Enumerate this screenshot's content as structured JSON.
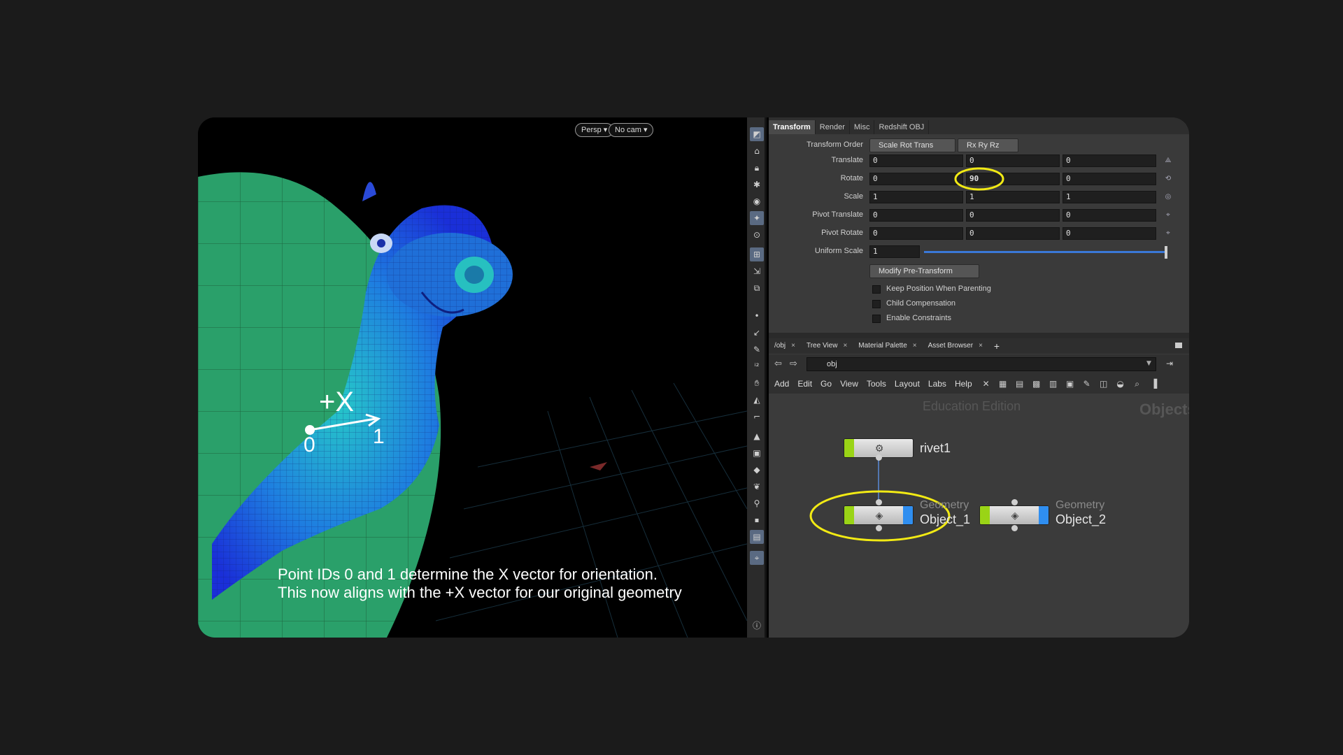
{
  "viewport": {
    "persp_label": "Persp ▾",
    "cam_label": "No cam ▾",
    "axis_label": "+X",
    "point0": "0",
    "point1": "1",
    "caption_line1": "Point IDs 0 and 1 determine the X vector for orientation.",
    "caption_line2": "This now aligns with the +X vector for our original geometry"
  },
  "params": {
    "tabs": [
      "Transform",
      "Render",
      "Misc",
      "Redshift OBJ"
    ],
    "active_tab": "Transform",
    "transform_order_label": "Transform Order",
    "transform_order_value": "Scale Rot Trans",
    "rotate_order_value": "Rx Ry Rz",
    "rows": [
      {
        "label": "Translate",
        "values": [
          "0",
          "0",
          "0"
        ]
      },
      {
        "label": "Rotate",
        "values": [
          "0",
          "90",
          "0"
        ]
      },
      {
        "label": "Scale",
        "values": [
          "1",
          "1",
          "1"
        ]
      },
      {
        "label": "Pivot Translate",
        "values": [
          "0",
          "0",
          "0"
        ]
      },
      {
        "label": "Pivot Rotate",
        "values": [
          "0",
          "0",
          "0"
        ]
      }
    ],
    "uniform_scale_label": "Uniform Scale",
    "uniform_scale_value": "1",
    "modify_menu": "Modify Pre-Transform",
    "checkboxes": [
      "Keep Position When Parenting",
      "Child Compensation",
      "Enable Constraints"
    ],
    "highlight_color": "#f2ea14"
  },
  "network": {
    "tabs": [
      "/obj",
      "Tree View",
      "Material Palette",
      "Asset Browser"
    ],
    "path": "obj",
    "menu": [
      "Add",
      "Edit",
      "Go",
      "View",
      "Tools",
      "Layout",
      "Labs",
      "Help"
    ],
    "watermark_edition": "Education Edition",
    "watermark_context": "Objects",
    "nodes": {
      "rivet": {
        "name": "rivet1"
      },
      "obj1": {
        "type": "Geometry",
        "name": "Object_1"
      },
      "obj2": {
        "type": "Geometry",
        "name": "Object_2"
      }
    }
  }
}
